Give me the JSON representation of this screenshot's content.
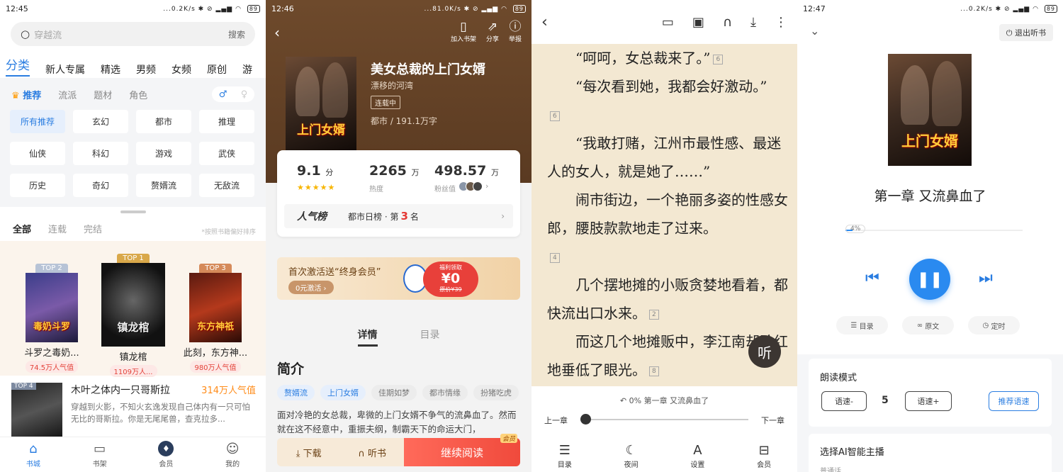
{
  "panel1": {
    "status": {
      "time": "12:45",
      "net": "...0.2K/s",
      "battery": "89"
    },
    "search": {
      "placeholder": "穿越流",
      "button": "搜索"
    },
    "tabs": [
      "分类",
      "新人专属",
      "精选",
      "男频",
      "女频",
      "原创",
      "游"
    ],
    "subtabs": {
      "recommend": "推荐",
      "style": "流派",
      "theme": "题材",
      "role": "角色"
    },
    "genres": [
      "所有推荐",
      "玄幻",
      "都市",
      "推理",
      "仙侠",
      "科幻",
      "游戏",
      "武侠",
      "历史",
      "奇幻",
      "赘婿流",
      "无敌流"
    ],
    "rank_tabs": [
      "全部",
      "连载",
      "完结"
    ],
    "rank_hint": "*按照书籍偏好排序",
    "top3": [
      {
        "badge": "TOP 2",
        "title": "斗罗之毒奶...",
        "pop": "74.5万人气值",
        "cover_text": "毒奶斗罗"
      },
      {
        "badge": "TOP 1",
        "title": "镇龙棺",
        "pop": "1109万人...",
        "cover_text": "镇龙棺"
      },
      {
        "badge": "TOP 3",
        "title": "此刻，东方神...",
        "pop": "980万人气值",
        "cover_text": "东方神祇"
      }
    ],
    "top4": {
      "badge": "TOP 4",
      "title": "木叶之体内一只哥斯拉",
      "pop": "314万人气值",
      "desc": "穿越到火影，不知火玄逸发现自己体内有一只可怕无比的哥斯拉。你是无尾尾兽，查克拉多..."
    },
    "nav": [
      {
        "label": "书城",
        "icon": "home-icon"
      },
      {
        "label": "书架",
        "icon": "book-icon"
      },
      {
        "label": "会员",
        "icon": "vip-icon"
      },
      {
        "label": "我的",
        "icon": "profile-icon"
      }
    ]
  },
  "panel2": {
    "status": {
      "time": "12:46",
      "net": "...81.0K/s",
      "battery": "89"
    },
    "actions": [
      "加入书架",
      "分享",
      "举报"
    ],
    "book": {
      "title": "美女总裁的上门女婿",
      "author": "漂移的河湾",
      "status": "连载中",
      "meta": "都市 / 191.1万字",
      "cover_text": "上门女婿"
    },
    "stats": {
      "score": "9.1",
      "score_unit": "分",
      "heat": "2265",
      "heat_unit": "万",
      "heat_label": "热度",
      "fans": "498.57",
      "fans_unit": "万",
      "fans_label": "粉丝值"
    },
    "rank": {
      "logo": "人气榜",
      "prefix": "都市日榜 · 第",
      "num": "3",
      "suffix": "名"
    },
    "banner": {
      "text": "首次激活送“终身会员”",
      "btn": "0元激活",
      "coin_label": "福利领取",
      "coin_val": "¥0",
      "coin_sub": "原价¥39"
    },
    "detail_tabs": [
      "详情",
      "目录"
    ],
    "intro_title": "简介",
    "tags": [
      "赘婿流",
      "上门女婿",
      "佳期如梦",
      "都市情缘",
      "扮猪吃虎"
    ],
    "desc": "面对冷艳的女总裁，卑微的上门女婿不争气的流鼻血了。然而就在这不经意中，重振夫纲，制霸天下的命运大门，",
    "bottom": {
      "download": "下载",
      "listen": "听书",
      "read": "继续阅读",
      "vip": "会员"
    }
  },
  "panel3": {
    "lines": [
      {
        "text": "“呵呵，女总裁来了。”",
        "cm": "6"
      },
      {
        "text": "“每次看到她，我都会好激动。”",
        "cm": "6"
      },
      {
        "text": "“我敢打赌，江州市最性感、最迷人的女人，就是她了……”",
        "cm": ""
      },
      {
        "text": "闹市街边，一个艳丽多姿的性感女郎，腰肢款款地走了过来。",
        "cm": "4"
      },
      {
        "text": "几个摆地摊的小贩贪婪地看着，都快流出口水来。",
        "cm": "2"
      },
      {
        "text": "而这几个地摊贩中，李江南却脸红地垂低了眼光。",
        "cm": "8"
      }
    ],
    "listen_btn": "听",
    "progress": "0%  第一章 又流鼻血了",
    "prev": "上一章",
    "next": "下一章",
    "menu": [
      {
        "label": "目录",
        "icon": "list-icon"
      },
      {
        "label": "夜间",
        "icon": "moon-icon"
      },
      {
        "label": "设置",
        "icon": "font-icon"
      },
      {
        "label": "会员",
        "icon": "gift-icon"
      }
    ]
  },
  "panel4": {
    "status": {
      "time": "12:47",
      "net": "...0.2K/s",
      "battery": "89"
    },
    "exit": "退出听书",
    "chapter": "第一章  又流鼻血了",
    "progress": "4%",
    "progress_value": 0.04,
    "play_icon": "pause-icon",
    "opts": [
      "目录",
      "原文",
      "定时"
    ],
    "mode_title": "朗读模式",
    "speed_down": "语速-",
    "speed_val": "5",
    "speed_up": "语速+",
    "recommend": "推荐语速",
    "ai_title": "选择AI智能主播",
    "ai_sub": "普通话"
  }
}
